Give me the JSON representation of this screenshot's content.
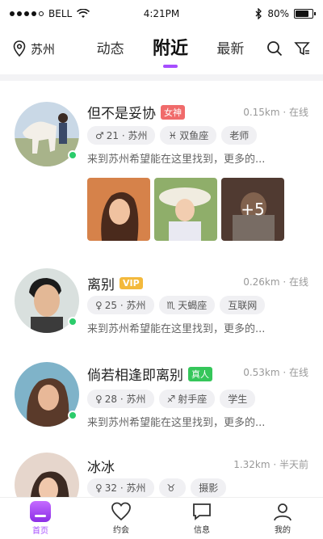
{
  "status": {
    "carrier": "BELL",
    "time": "4:21PM",
    "battery": "80%",
    "battery_level": 0.8
  },
  "nav": {
    "location": "苏州",
    "tabs": [
      {
        "label": "动态"
      },
      {
        "label": "附近"
      },
      {
        "label": "最新"
      }
    ],
    "active_tab": "附近",
    "accent": "#a64dff"
  },
  "users": [
    {
      "name": "但不是妥协",
      "badge": "女神",
      "distance": "0.15km · 在线",
      "tags": [
        "21 · 苏州",
        "双鱼座",
        "老师"
      ],
      "bio": "来到苏州希望能在这里找到，更多的...",
      "photos_more": "+5"
    },
    {
      "name": "离别",
      "badge": "VIP",
      "distance": "0.26km · 在线",
      "tags": [
        "25 · 苏州",
        "天蝎座",
        "互联网"
      ],
      "bio": "来到苏州希望能在这里找到，更多的..."
    },
    {
      "name": "倘若相逢即离别",
      "badge": "真人",
      "distance": "0.53km · 在线",
      "tags": [
        "28 · 苏州",
        "射手座",
        "学生"
      ],
      "bio": "来到苏州希望能在这里找到，更多的..."
    },
    {
      "name": "冰冰",
      "distance": "1.32km · 半天前",
      "tags": [
        "32 · 苏州",
        "",
        "摄影"
      ]
    }
  ],
  "tabbar": [
    {
      "label": "首页"
    },
    {
      "label": "约会"
    },
    {
      "label": "信息"
    },
    {
      "label": "我的"
    }
  ],
  "colors": {
    "accent": "#a64dff",
    "online": "#2bcc6b",
    "goddess_badge": "#f06b6b",
    "vip_badge": "#f3b93c",
    "real_badge": "#35c65a"
  }
}
